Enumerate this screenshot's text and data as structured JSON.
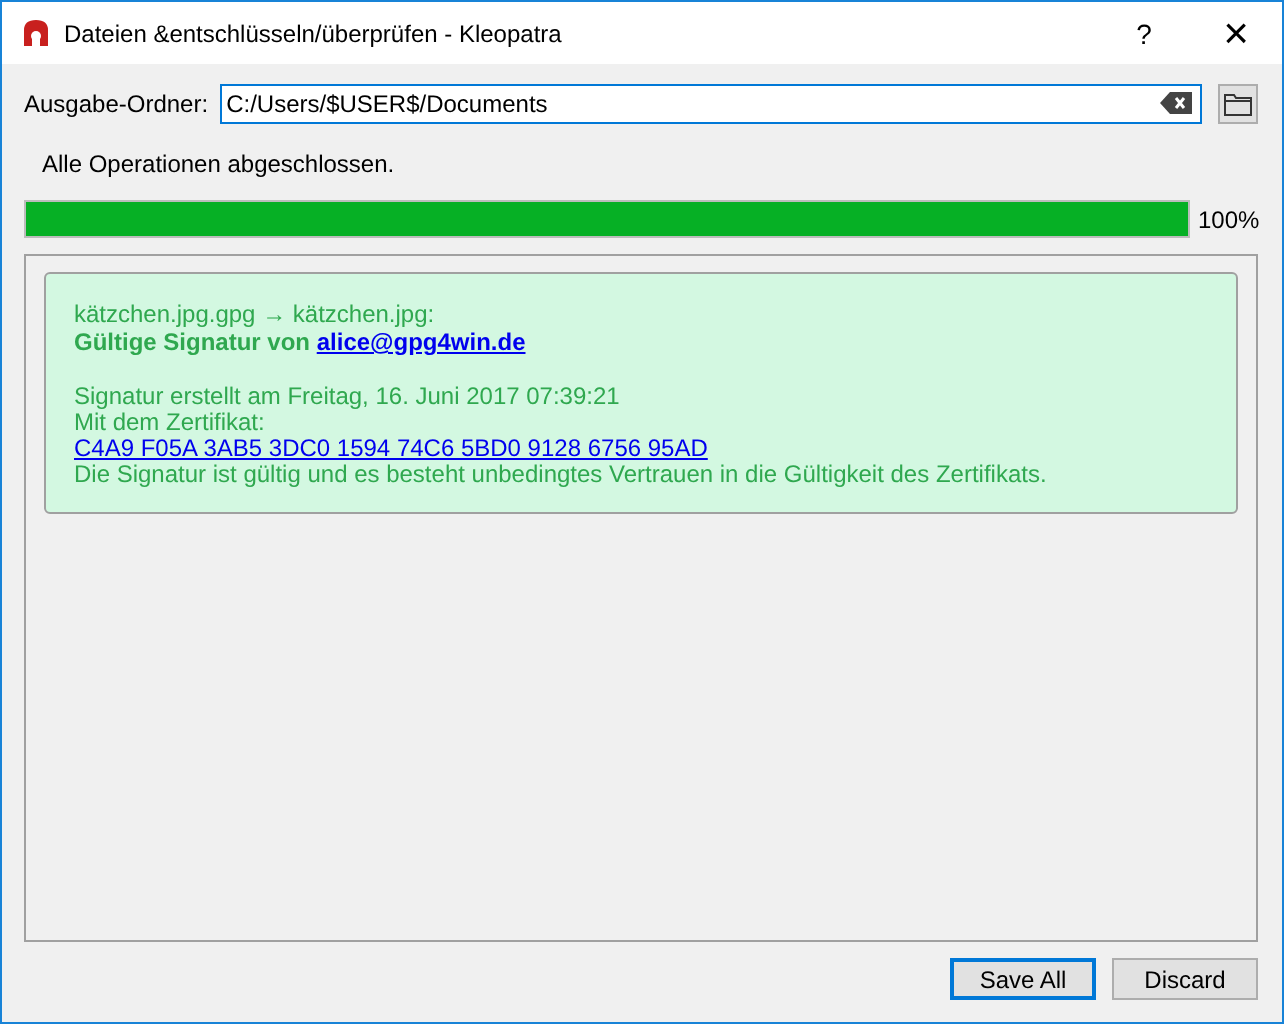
{
  "window": {
    "title": "Dateien &entschlüsseln/überprüfen - Kleopatra",
    "help": "?",
    "close": "×"
  },
  "output_folder": {
    "label": "Ausgabe-Ordner:",
    "value": "C:/Users/$USER$/Documents"
  },
  "status": "Alle Operationen abgeschlossen.",
  "progress": {
    "level": 1,
    "reading": "100%"
  },
  "results": [
    {
      "files": "kätzchen.jpg.gpg → kätzchen.jpg:",
      "verdict": "Gültige Signatur von",
      "signer": "alice@gpg4win.de",
      "created": "Signatur erstellt am Freitag, 16. Juni 2017 07:39:21",
      "cert_label": "Mit dem Zertifikat:",
      "fingerprint": "C4A9 F05A 3AB5 3DC0 1594 74C6 5BD0 9128 6756 95AD",
      "trust": "Die Signatur ist gültig und es besteht unbedingtes Vertrauen in die Gültigkeit des Zertifikats."
    }
  ],
  "buttons": [
    {
      "label": "Save All",
      "selected": true
    },
    {
      "label": "Discard",
      "selected": false
    }
  ]
}
